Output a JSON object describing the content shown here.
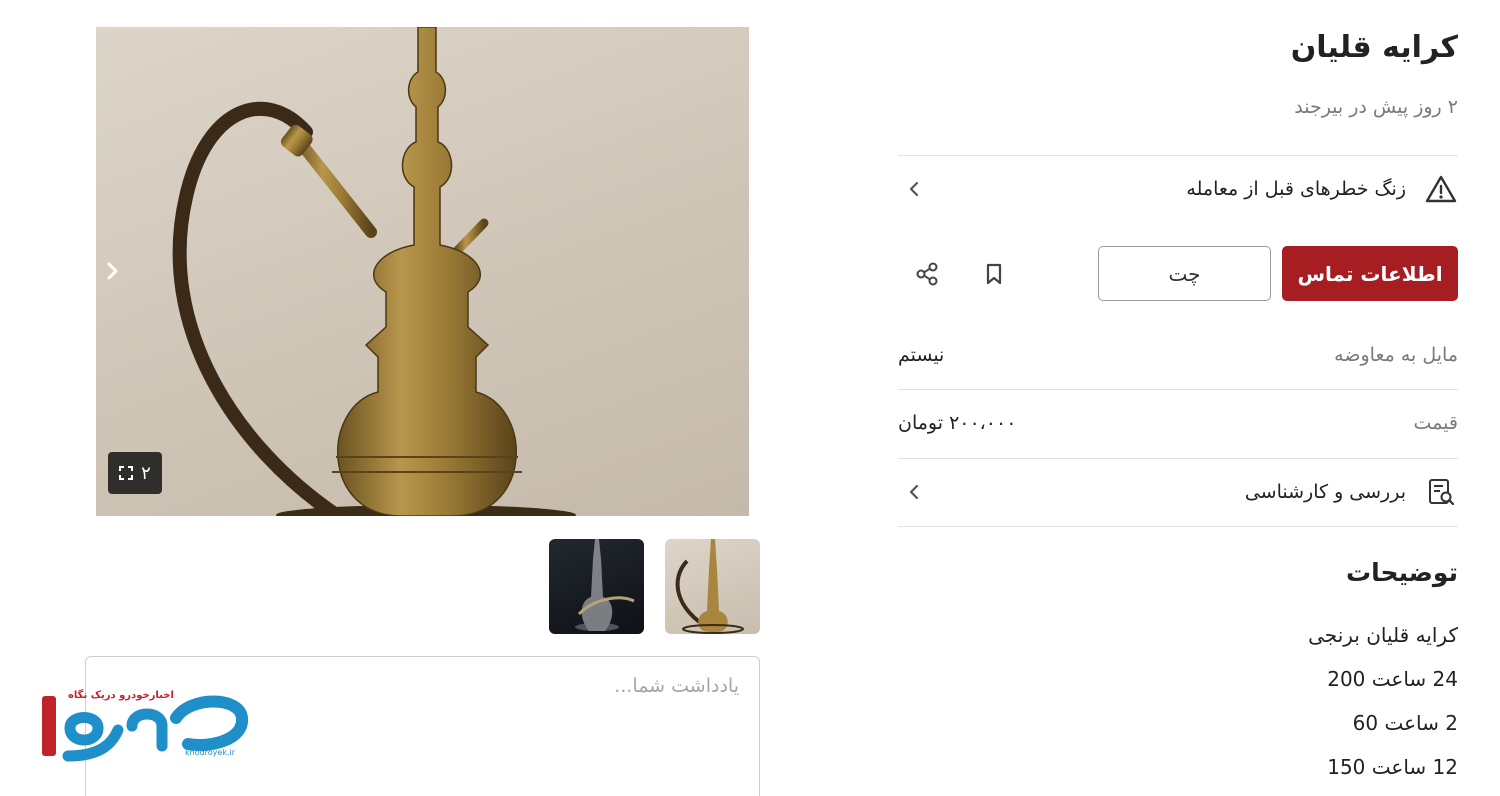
{
  "ad": {
    "title": "کرایه قلیان",
    "subtitle": "۲ روز پیش در بیرجند"
  },
  "warning": {
    "label": "زنگ خطرهای قبل از معامله",
    "icon": "warning-triangle-icon"
  },
  "actions": {
    "contact_label": "اطلاعات تماس",
    "chat_label": "چت",
    "bookmark_icon": "bookmark-icon",
    "share_icon": "share-icon"
  },
  "details": [
    {
      "key": "مایل به معاوضه",
      "value": "نیستم"
    },
    {
      "key": "قیمت",
      "value": "۲۰۰،۰۰۰ تومان"
    }
  ],
  "inspection": {
    "label": "بررسی و کارشناسی",
    "icon": "inspection-report-icon"
  },
  "description": {
    "title": "توضیحات",
    "lines": [
      "کرایه قلیان برنجی",
      "24 ساعت 200",
      "2 ساعت 60",
      "12 ساعت 150"
    ]
  },
  "gallery": {
    "counter": "۲",
    "image_count": 2
  },
  "note": {
    "placeholder": "یادداشت شما..."
  },
  "watermark": {
    "logo_text": "خودرو",
    "tagline": "اخبارخودرو دریک نگاه",
    "site": "khodroyek.ir"
  },
  "colors": {
    "accent": "#a61d22",
    "watermark_red": "#c0232b",
    "watermark_blue": "#1e8fc8"
  }
}
